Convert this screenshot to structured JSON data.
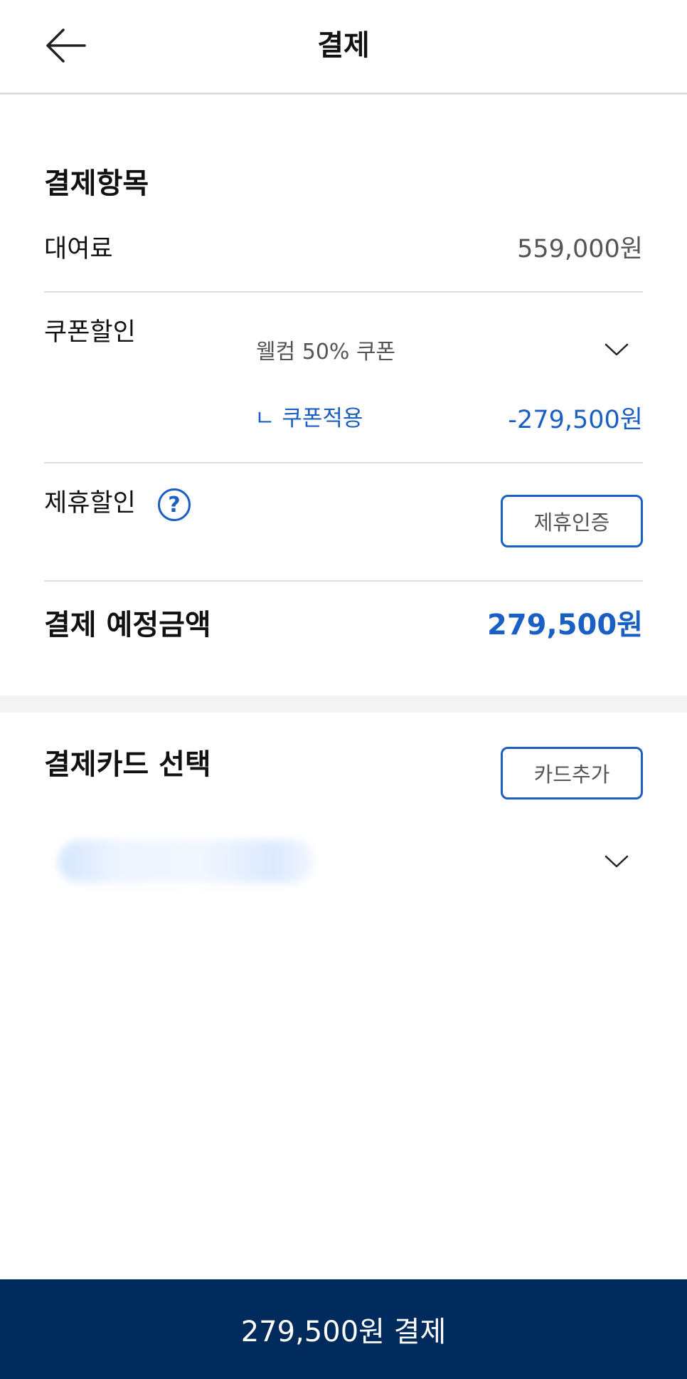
{
  "header": {
    "title": "결제",
    "back_icon": "arrow-left-icon"
  },
  "payment_items": {
    "title": "결제항목",
    "rental_fee_label": "대여료",
    "rental_fee_value": "559,000원",
    "coupon_label": "쿠폰할인",
    "coupon_selected": "웰컴 50% 쿠폰",
    "coupon_applied_label": "ㄴ 쿠폰적용",
    "coupon_applied_value": "-279,500원",
    "partner_label": "제휴할인",
    "partner_help": "?",
    "partner_button": "제휴인증",
    "total_label": "결제 예정금액",
    "total_value": "279,500원"
  },
  "card_section": {
    "title": "결제카드 선택",
    "add_button": "카드추가"
  },
  "footer": {
    "pay_button": "279,500원 결제"
  },
  "colors": {
    "accent": "#1a5fc4",
    "pay_bar": "#012b5c",
    "divider": "#dcdcdc"
  }
}
